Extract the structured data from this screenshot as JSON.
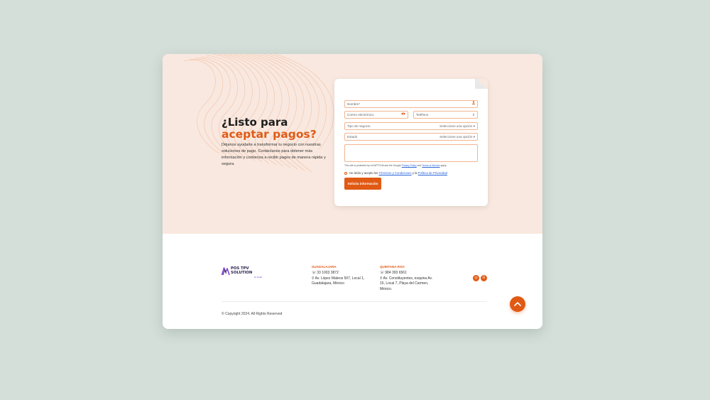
{
  "hero": {
    "title_line1": "¿Listo para",
    "title_line2": "aceptar pagos?",
    "description": "Déjanos ayudarte a transformar tu negocio con nuestras soluciones de pago. Contáctanos para obtener más información y comienza a recibir pagos de manera rápida y segura."
  },
  "form": {
    "name_placeholder": "Nombre*",
    "email_placeholder": "Correo electrónico",
    "phone_placeholder": "Teléfono",
    "business_type_placeholder": "Tipo de negocio",
    "business_type_value": "Seleccione una opción",
    "state_placeholder": "Estado",
    "state_value": "Seleccione una opción",
    "recaptcha_prefix": "This site is protected by reCAPTCHA and the Google",
    "privacy_policy": "Privacy Policy",
    "recaptcha_and": "and",
    "terms_of_service": "Terms of Service",
    "recaptcha_suffix": "apply.",
    "accept_prefix": "He leído y acepto los",
    "terms_link": "Términos y Condiciones",
    "accept_and": "y la",
    "privacy_link": "Política de Privacidad",
    "submit_label": "Solicita información"
  },
  "footer": {
    "logo_text_line1": "POS TPV",
    "logo_text_line2": "SOLUTION",
    "logo_sub": "by Nueb",
    "guadalajara": {
      "title": "GUADALAJARA",
      "phone": "33 1003 3872",
      "address_line1": "Av. López Mateos 507, Local 1,",
      "address_line2": "Guadalajara, México"
    },
    "quintana_roo": {
      "title": "QUINTANA ROO",
      "phone": "984 393 6561",
      "address_line1": "Av. Constituyentes, esquina Av.",
      "address_line2": "15, Local 7, Playa del Carmen,",
      "address_line3": "México."
    },
    "copyright": "© Copyright 2024. All Rights Reserved"
  },
  "icons": {
    "user": "user-icon",
    "eye": "eye-icon",
    "phone": "phone-icon",
    "location": "location-pin-icon",
    "instagram": "instagram-icon",
    "google": "google-icon",
    "back_to_top": "chevron-up-icon"
  },
  "colors": {
    "accent": "#e05a14",
    "hero_background": "#f9e8df",
    "page_background": "#d5dfda",
    "logo_dark": "#2b2450",
    "logo_purple": "#7a3bd1"
  }
}
